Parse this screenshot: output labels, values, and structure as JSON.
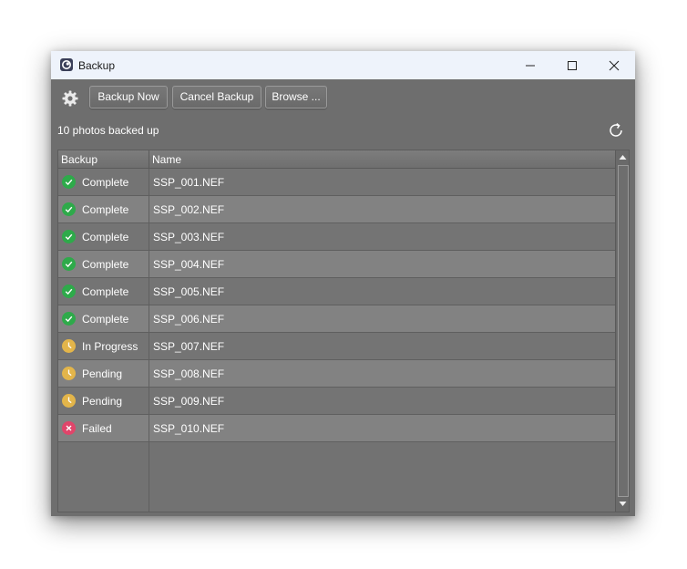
{
  "window": {
    "title": "Backup"
  },
  "toolbar": {
    "settings_icon": "gear-icon",
    "backup_now_label": "Backup Now",
    "cancel_backup_label": "Cancel Backup",
    "browse_label": "Browse ..."
  },
  "status": {
    "summary": "10 photos backed up",
    "refresh_icon": "refresh-icon"
  },
  "table": {
    "columns": [
      "Backup",
      "Name"
    ],
    "rows": [
      {
        "status": "Complete",
        "state": "complete",
        "name": "SSP_001.NEF"
      },
      {
        "status": "Complete",
        "state": "complete",
        "name": "SSP_002.NEF"
      },
      {
        "status": "Complete",
        "state": "complete",
        "name": "SSP_003.NEF"
      },
      {
        "status": "Complete",
        "state": "complete",
        "name": "SSP_004.NEF"
      },
      {
        "status": "Complete",
        "state": "complete",
        "name": "SSP_005.NEF"
      },
      {
        "status": "Complete",
        "state": "complete",
        "name": "SSP_006.NEF"
      },
      {
        "status": "In Progress",
        "state": "pending",
        "name": "SSP_007.NEF"
      },
      {
        "status": "Pending",
        "state": "pending",
        "name": "SSP_008.NEF"
      },
      {
        "status": "Pending",
        "state": "pending",
        "name": "SSP_009.NEF"
      },
      {
        "status": "Failed",
        "state": "failed",
        "name": "SSP_010.NEF"
      }
    ]
  },
  "colors": {
    "complete": "#2eaa4a",
    "pending": "#e3b54a",
    "failed": "#e0456a",
    "window_bg": "#6e6e6e",
    "titlebar_bg": "#eef3fb"
  }
}
